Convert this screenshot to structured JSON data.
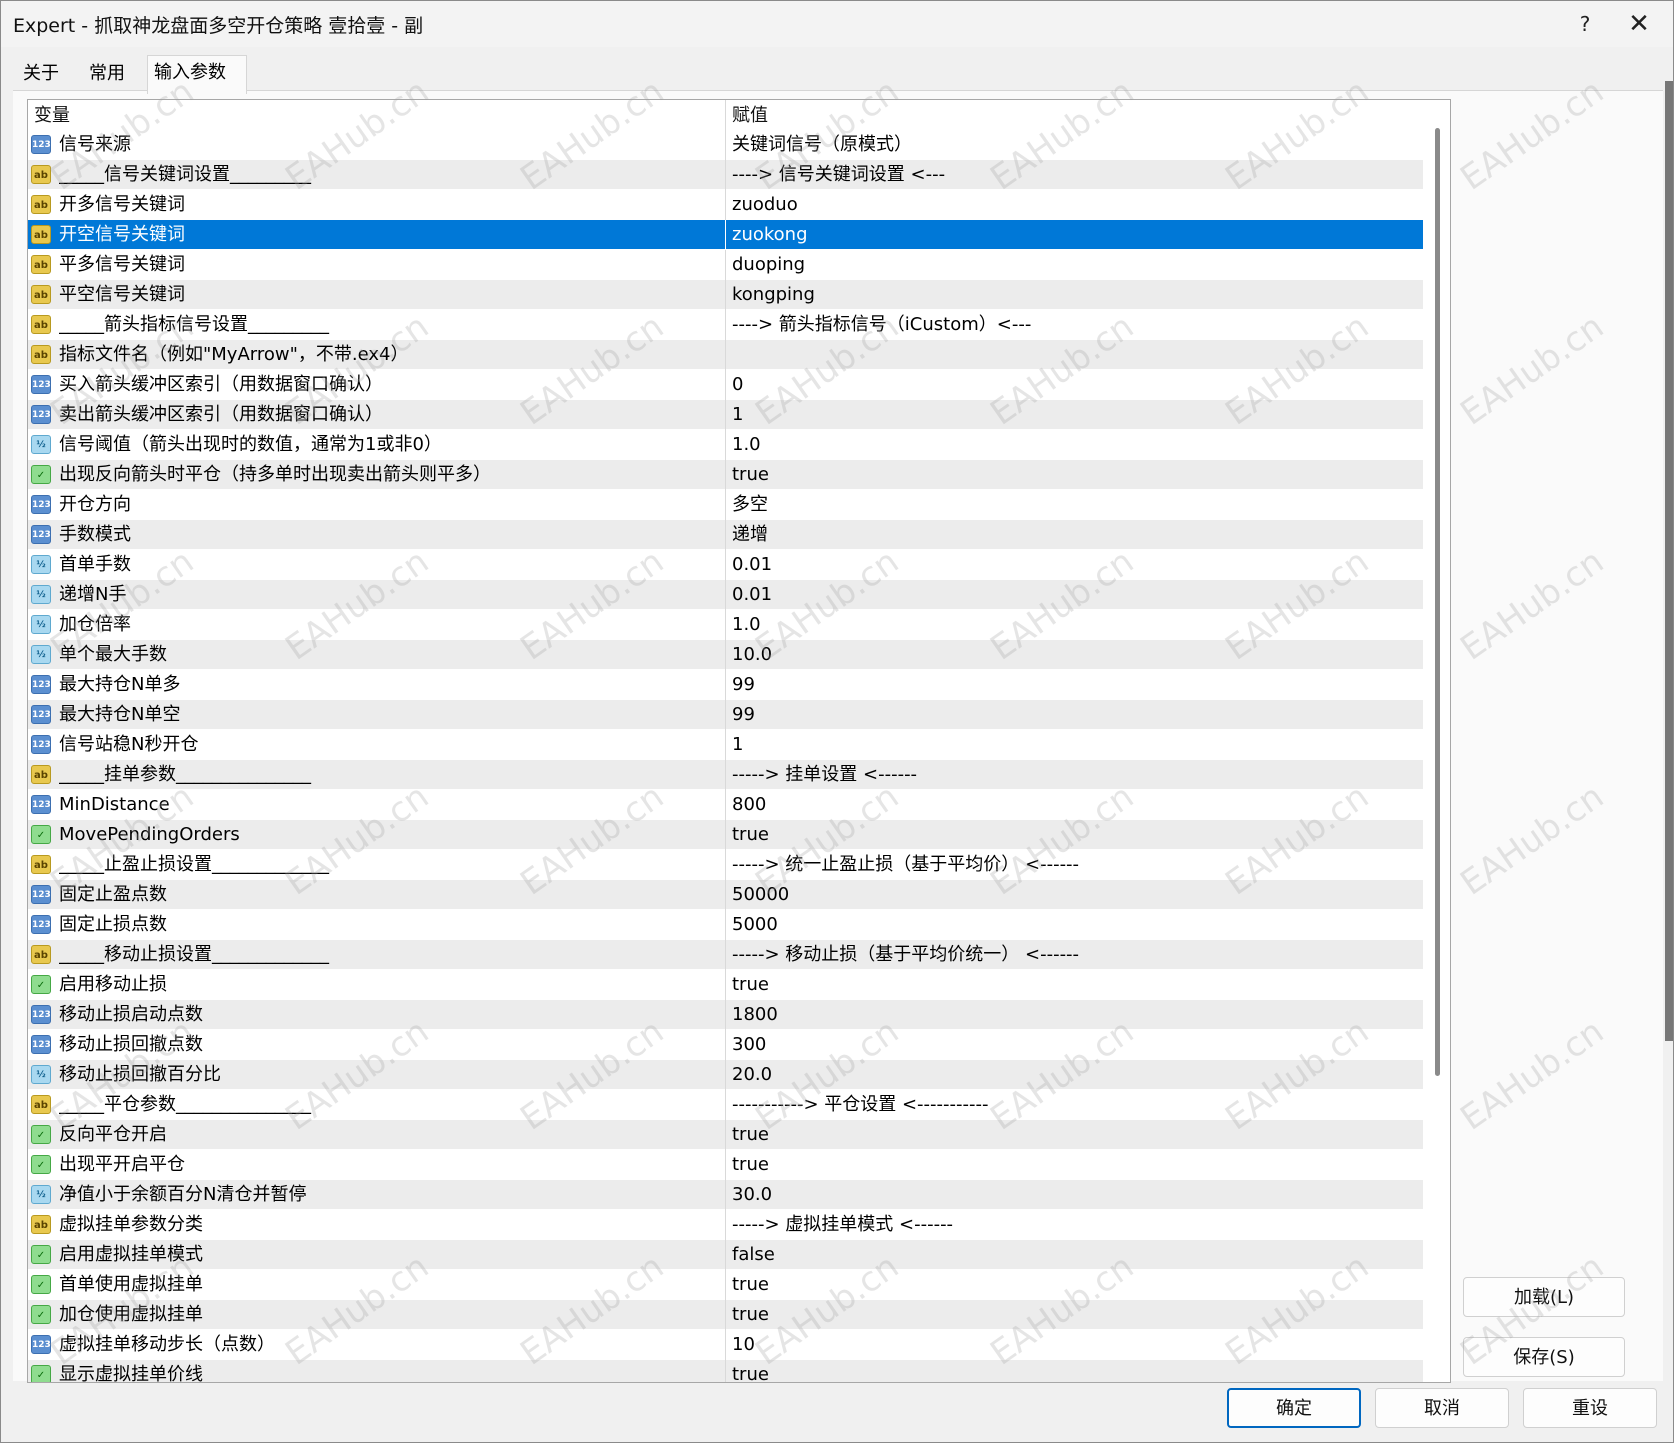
{
  "window": {
    "title": "Expert - 抓取神龙盘面多空开仓策略 壹拾壹 - 副",
    "help_label": "?",
    "close_label": "✕"
  },
  "tabs": [
    {
      "label": "关于"
    },
    {
      "label": "常用"
    },
    {
      "label": "输入参数",
      "active": true
    }
  ],
  "grid": {
    "header": {
      "variable": "变量",
      "value": "赋值"
    },
    "rows": [
      {
        "type": "int",
        "name": "信号来源",
        "value": "关键词信号（原模式）"
      },
      {
        "type": "str",
        "name": "_____信号关键词设置_________",
        "value": "----> 信号关键词设置 <---"
      },
      {
        "type": "str",
        "name": "开多信号关键词",
        "value": "zuoduo"
      },
      {
        "type": "str",
        "name": "开空信号关键词",
        "value": "zuokong",
        "selected": true
      },
      {
        "type": "str",
        "name": "平多信号关键词",
        "value": "duoping"
      },
      {
        "type": "str",
        "name": "平空信号关键词",
        "value": "kongping"
      },
      {
        "type": "str",
        "name": "_____箭头指标信号设置_________",
        "value": "----> 箭头指标信号（iCustom）<---"
      },
      {
        "type": "str",
        "name": "指标文件名（例如\"MyArrow\"，不带.ex4）",
        "value": ""
      },
      {
        "type": "int",
        "name": "买入箭头缓冲区索引（用数据窗口确认）",
        "value": "0"
      },
      {
        "type": "int",
        "name": "卖出箭头缓冲区索引（用数据窗口确认）",
        "value": "1"
      },
      {
        "type": "dbl",
        "name": "信号阈值（箭头出现时的数值，通常为1或非0）",
        "value": "1.0"
      },
      {
        "type": "bool",
        "name": "出现反向箭头时平仓（持多单时出现卖出箭头则平多）",
        "value": "true"
      },
      {
        "type": "int",
        "name": "开仓方向",
        "value": "多空"
      },
      {
        "type": "int",
        "name": "手数模式",
        "value": "递增"
      },
      {
        "type": "dbl",
        "name": "首单手数",
        "value": "0.01"
      },
      {
        "type": "dbl",
        "name": "递增N手",
        "value": "0.01"
      },
      {
        "type": "dbl",
        "name": "加仓倍率",
        "value": "1.0"
      },
      {
        "type": "dbl",
        "name": "单个最大手数",
        "value": "10.0"
      },
      {
        "type": "int",
        "name": "最大持仓N单多",
        "value": "99"
      },
      {
        "type": "int",
        "name": "最大持仓N单空",
        "value": "99"
      },
      {
        "type": "int",
        "name": "信号站稳N秒开仓",
        "value": "1"
      },
      {
        "type": "str",
        "name": "_____挂单参数_______________",
        "value": "-----> 挂单设置 <------"
      },
      {
        "type": "int",
        "name": "MinDistance",
        "value": "800"
      },
      {
        "type": "bool",
        "name": "MovePendingOrders",
        "value": "true"
      },
      {
        "type": "str",
        "name": "_____止盈止损设置_____________",
        "value": "-----> 统一止盈止损（基于平均价） <------"
      },
      {
        "type": "int",
        "name": "固定止盈点数",
        "value": "50000"
      },
      {
        "type": "int",
        "name": "固定止损点数",
        "value": "5000"
      },
      {
        "type": "str",
        "name": "_____移动止损设置_____________",
        "value": "-----> 移动止损（基于平均价统一） <------"
      },
      {
        "type": "bool",
        "name": "启用移动止损",
        "value": "true"
      },
      {
        "type": "int",
        "name": "移动止损启动点数",
        "value": "1800"
      },
      {
        "type": "int",
        "name": "移动止损回撤点数",
        "value": "300"
      },
      {
        "type": "dbl",
        "name": "移动止损回撤百分比",
        "value": "20.0"
      },
      {
        "type": "str",
        "name": "_____平仓参数_______________",
        "value": "-----------> 平仓设置 <-----------"
      },
      {
        "type": "bool",
        "name": "反向平仓开启",
        "value": "true"
      },
      {
        "type": "bool",
        "name": "出现平开启平仓",
        "value": "true"
      },
      {
        "type": "dbl",
        "name": "净值小于余额百分N清仓并暂停",
        "value": "30.0"
      },
      {
        "type": "str",
        "name": "虚拟挂单参数分类",
        "value": "-----> 虚拟挂单模式 <------"
      },
      {
        "type": "bool",
        "name": "启用虚拟挂单模式",
        "value": "false"
      },
      {
        "type": "bool",
        "name": "首单使用虚拟挂单",
        "value": "true"
      },
      {
        "type": "bool",
        "name": "加仓使用虚拟挂单",
        "value": "true"
      },
      {
        "type": "int",
        "name": "虚拟挂单移动步长（点数）",
        "value": "10"
      },
      {
        "type": "bool",
        "name": "显示虚拟挂单价线",
        "value": "true"
      }
    ]
  },
  "icons": {
    "int": {
      "name": "integer-type-icon",
      "glyph": "123"
    },
    "str": {
      "name": "string-type-icon",
      "glyph": "ab"
    },
    "dbl": {
      "name": "double-type-icon",
      "glyph": "½"
    },
    "bool": {
      "name": "bool-type-icon",
      "glyph": "✓"
    }
  },
  "buttons": {
    "load": "加载(L)",
    "save": "保存(S)",
    "ok": "确定",
    "cancel": "取消",
    "reset": "重设"
  },
  "watermark": "EAHub.cn",
  "colors": {
    "selection": "#0078d7",
    "ok_border": "#0067c0"
  }
}
